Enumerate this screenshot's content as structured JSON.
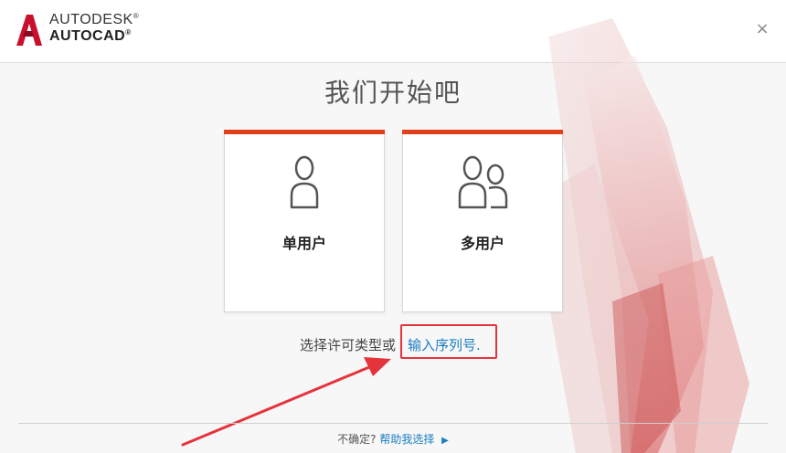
{
  "header": {
    "brand_line1": "AUTODESK",
    "brand_line2": "AUTOCAD",
    "registered": "®",
    "close_glyph": "×"
  },
  "main": {
    "title": "我们开始吧",
    "cards": [
      {
        "label": "单用户",
        "icon": "single-user-icon"
      },
      {
        "label": "多用户",
        "icon": "multi-user-icon"
      }
    ],
    "prompt": "选择许可类型或",
    "serial_link": "输入序列号."
  },
  "footer": {
    "question": "不确定?",
    "help_link": "帮助我选择",
    "arrow_glyph": "▶"
  },
  "colors": {
    "accent": "#e0401c",
    "link": "#1a7dc4",
    "highlight": "#e5333c",
    "logo": "#c8102e"
  }
}
